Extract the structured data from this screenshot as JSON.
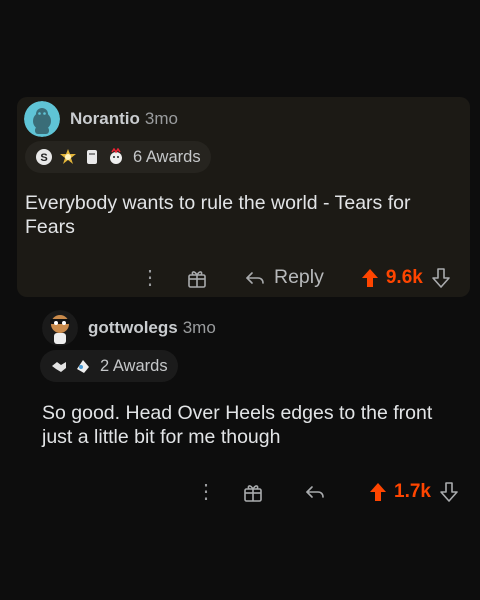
{
  "comment": {
    "author": "Norantio",
    "age": "3mo",
    "awards_label": "6 Awards",
    "body": "Everybody wants to rule the world - Tears for Fears",
    "reply_label": "Reply",
    "score": "9.6k"
  },
  "reply": {
    "author": "gottwolegs",
    "age": "3mo",
    "awards_label": "2 Awards",
    "body": "So good. Head Over Heels edges to the front just a little bit for me though",
    "score": "1.7k"
  },
  "colors": {
    "upvote": "#ff4500",
    "card_bg": "#1c1a15",
    "page_bg": "#0d0d0d"
  }
}
